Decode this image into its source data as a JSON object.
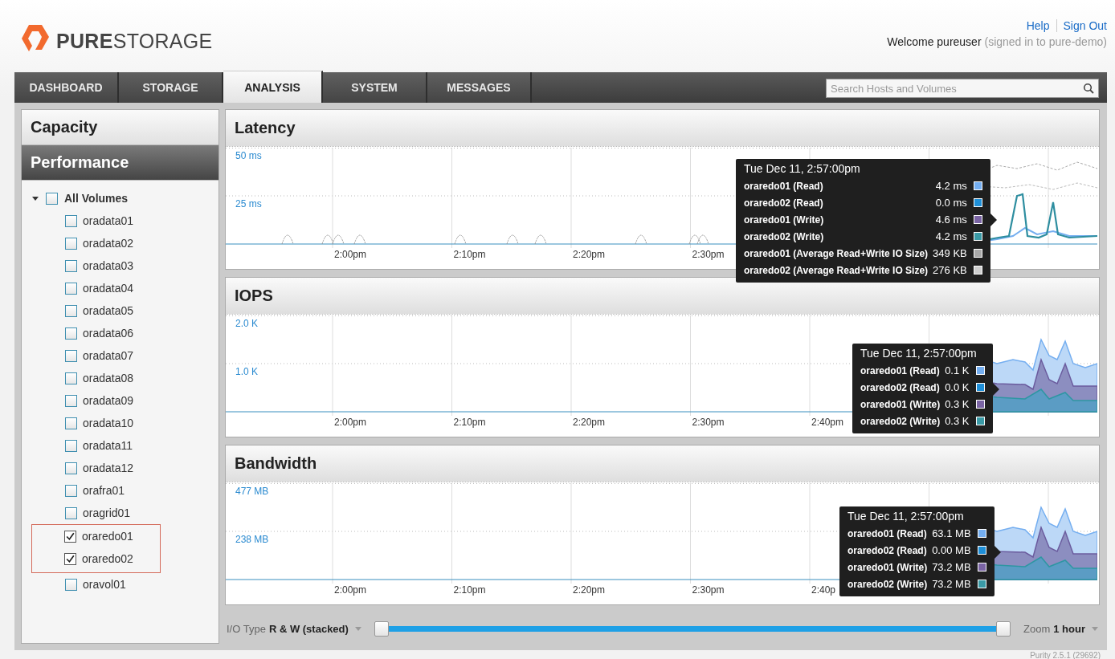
{
  "logo": {
    "text": "**PURE**STORAGE"
  },
  "header": {
    "links": [
      "Help",
      "Sign Out"
    ],
    "welcome": "Welcome pureuser",
    "signed_in": "(signed in to pure-demo)"
  },
  "tabs": [
    {
      "label": "DASHBOARD",
      "selected": false
    },
    {
      "label": "STORAGE",
      "selected": false
    },
    {
      "label": "ANALYSIS",
      "selected": true
    },
    {
      "label": "SYSTEM",
      "selected": false
    },
    {
      "label": "MESSAGES",
      "selected": false
    }
  ],
  "search": {
    "placeholder": "Search Hosts and Volumes"
  },
  "sidebar": {
    "sections": [
      {
        "label": "Capacity",
        "selected": false
      },
      {
        "label": "Performance",
        "selected": true
      }
    ],
    "tree": {
      "label": "All Volumes",
      "expanded": true,
      "checked": false,
      "children": [
        {
          "label": "oradata01",
          "checked": false,
          "highlighted": false
        },
        {
          "label": "oradata02",
          "checked": false,
          "highlighted": false
        },
        {
          "label": "oradata03",
          "checked": false,
          "highlighted": false
        },
        {
          "label": "oradata04",
          "checked": false,
          "highlighted": false
        },
        {
          "label": "oradata05",
          "checked": false,
          "highlighted": false
        },
        {
          "label": "oradata06",
          "checked": false,
          "highlighted": false
        },
        {
          "label": "oradata07",
          "checked": false,
          "highlighted": false
        },
        {
          "label": "oradata08",
          "checked": false,
          "highlighted": false
        },
        {
          "label": "oradata09",
          "checked": false,
          "highlighted": false
        },
        {
          "label": "oradata10",
          "checked": false,
          "highlighted": false
        },
        {
          "label": "oradata11",
          "checked": false,
          "highlighted": false
        },
        {
          "label": "oradata12",
          "checked": false,
          "highlighted": false
        },
        {
          "label": "orafra01",
          "checked": false,
          "highlighted": false
        },
        {
          "label": "oragrid01",
          "checked": false,
          "highlighted": false
        },
        {
          "label": "oraredo01",
          "checked": true,
          "highlighted": true
        },
        {
          "label": "oraredo02",
          "checked": true,
          "highlighted": true
        },
        {
          "label": "oravol01",
          "checked": false,
          "highlighted": false
        }
      ]
    }
  },
  "charts": [
    {
      "title": "Latency",
      "kind": "lines",
      "y_labels": [
        "50 ms",
        "25 ms"
      ],
      "x_labels": [
        "2:00pm",
        "2:10pm",
        "2:20pm",
        "2:30pm"
      ],
      "tooltip": {
        "date": "Tue Dec 11, 2:57:00pm",
        "rows": [
          {
            "label": "oraredo01 (Read)",
            "value": "4.2 ms",
            "color": "#74aef0"
          },
          {
            "label": "oraredo02 (Read)",
            "value": "0.0 ms",
            "color": "#1e8fd8"
          },
          {
            "label": "oraredo01 (Write)",
            "value": "4.6 ms",
            "color": "#7a64a4"
          },
          {
            "label": "oraredo02 (Write)",
            "value": "4.2 ms",
            "color": "#3a9aa6"
          },
          {
            "label": "oraredo01 (Average Read+Write IO Size)",
            "value": "349 KB",
            "color": "#a9a9a9"
          },
          {
            "label": "oraredo02 (Average Read+Write IO Size)",
            "value": "276 KB",
            "color": "#cfcfcf"
          }
        ]
      }
    },
    {
      "title": "IOPS",
      "kind": "areas",
      "y_labels": [
        "2.0 K",
        "1.0 K"
      ],
      "x_labels": [
        "2:00pm",
        "2:10pm",
        "2:20pm",
        "2:30pm",
        "2:40pm"
      ],
      "tooltip": {
        "date": "Tue Dec 11, 2:57:00pm",
        "rows": [
          {
            "label": "oraredo01 (Read)",
            "value": "0.1 K",
            "color": "#74aef0"
          },
          {
            "label": "oraredo02 (Read)",
            "value": "0.0 K",
            "color": "#1e8fd8"
          },
          {
            "label": "oraredo01 (Write)",
            "value": "0.3 K",
            "color": "#7a64a4"
          },
          {
            "label": "oraredo02 (Write)",
            "value": "0.3 K",
            "color": "#3a9aa6"
          }
        ]
      }
    },
    {
      "title": "Bandwidth",
      "kind": "areas",
      "y_labels": [
        "477 MB",
        "238 MB"
      ],
      "x_labels": [
        "2:00pm",
        "2:10pm",
        "2:20pm",
        "2:30pm",
        "2:40p"
      ],
      "tooltip": {
        "date": "Tue Dec 11, 2:57:00pm",
        "rows": [
          {
            "label": "oraredo01 (Read)",
            "value": "63.1 MB",
            "color": "#74aef0"
          },
          {
            "label": "oraredo02 (Read)",
            "value": "0.00 MB",
            "color": "#1e8fd8"
          },
          {
            "label": "oraredo01 (Write)",
            "value": "73.2 MB",
            "color": "#7a64a4"
          },
          {
            "label": "oraredo02 (Write)",
            "value": "73.2 MB",
            "color": "#3a9aa6"
          }
        ]
      }
    }
  ],
  "controls": {
    "io_type": {
      "label": "I/O Type",
      "value": "R & W (stacked)"
    },
    "range": {
      "level": 1
    },
    "zoom": {
      "label": "Zoom",
      "value": "1 hour"
    }
  },
  "version": "Purity 2.5.1 (29692)"
}
